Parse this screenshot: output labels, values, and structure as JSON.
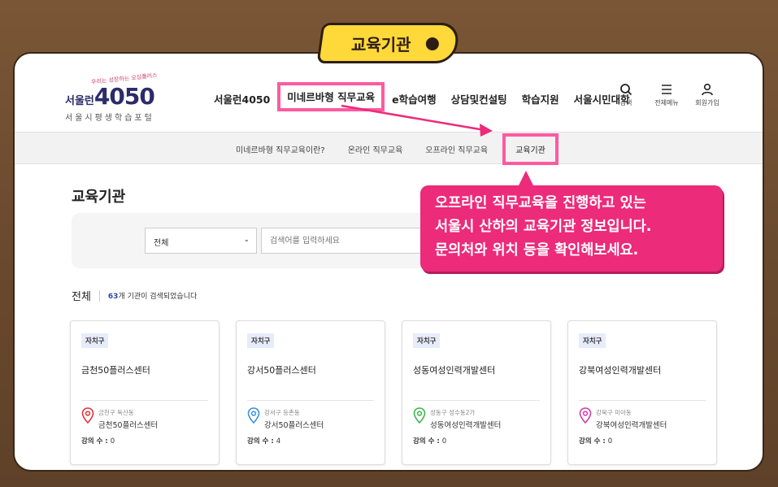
{
  "tag": {
    "label": "교육기관"
  },
  "logo": {
    "slogan": "우리는 성장하는 오십플러스",
    "seoul": "서울런",
    "number": "4050",
    "subtitle": "서울시평생학습포털"
  },
  "gnb": {
    "items": [
      "서울런4050",
      "미네르바형 직무교육",
      "e학습여행",
      "상담및컨설팅",
      "학습지원",
      "서울시민대학"
    ]
  },
  "utils": {
    "search": "검색",
    "menu": "전체메뉴",
    "signup": "회원가입"
  },
  "subnav": {
    "items": [
      "미네르바형 직무교육이란?",
      "온라인 직무교육",
      "오프라인 직무교육",
      "교육기관"
    ]
  },
  "page": {
    "title": "교육기관"
  },
  "search": {
    "select_value": "전체",
    "placeholder": "검색어를 입력하세요"
  },
  "results": {
    "title": "전체",
    "count": "63",
    "count_suffix": "개 기관이 검색되었습니다"
  },
  "cards": [
    {
      "badge": "자치구",
      "name": "금천50플러스센터",
      "addr": "금천구 독산동",
      "place": "금천50플러스센터",
      "count_label": "강의 수 : ",
      "count": "0",
      "pin_color": "#e0343a"
    },
    {
      "badge": "자치구",
      "name": "강서50플러스센터",
      "addr": "강서구 등촌동",
      "place": "강서50플러스센터",
      "count_label": "강의 수 : ",
      "count": "4",
      "pin_color": "#3a8fe0"
    },
    {
      "badge": "자치구",
      "name": "성동여성인력개발센터",
      "addr": "성동구 성수동2가",
      "place": "성동여성인력개발센터",
      "count_label": "강의 수 : ",
      "count": "0",
      "pin_color": "#3ab54a"
    },
    {
      "badge": "자치구",
      "name": "강북여성인력개발센터",
      "addr": "강북구 미아동",
      "place": "강북여성인력개발센터",
      "count_label": "강의 수 : ",
      "count": "0",
      "pin_color": "#d23aaa"
    }
  ],
  "callout": {
    "line1": "오프라인 직무교육을 진행하고 있는",
    "line2": "서울시 산하의 교육기관 정보입니다.",
    "line3": "문의처와 위치 등을 확인해보세요."
  },
  "colors": {
    "highlight": "#ff5aa0",
    "callout": "#ec2b7a",
    "tag": "#ffd83a",
    "accent_blue": "#2b4aa8"
  }
}
